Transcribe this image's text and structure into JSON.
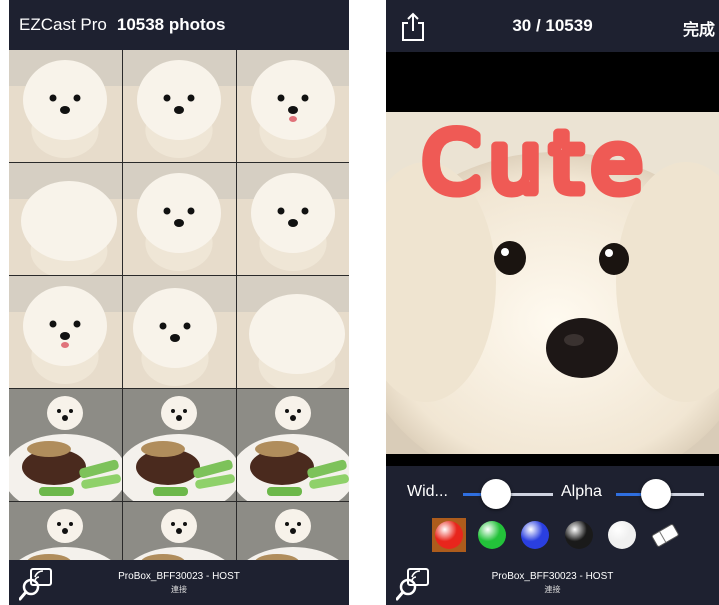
{
  "left": {
    "header": {
      "app_name": "EZCast Pro",
      "photo_count": "10538 photos"
    },
    "thumbnails": [
      "dog-face-front",
      "dog-face-front",
      "dog-face-smile",
      "dog-lying",
      "dog-face-up",
      "dog-face-front",
      "dog-face-smile",
      "dog-side",
      "dog-lying",
      "steak-plate",
      "steak-plate",
      "steak-plate",
      "steak-plate",
      "steak-plate",
      "steak-plate"
    ],
    "bottom_bar": {
      "device": "ProBox_BFF30023 - HOST",
      "status": "連接",
      "icon": "cast-search-icon"
    }
  },
  "right": {
    "header": {
      "pager": "30 / 10539",
      "done": "完成",
      "share_icon": "share-icon"
    },
    "annotation": {
      "text": "Cute",
      "color": "#ef5a55"
    },
    "tools": {
      "width_label": "Wid...",
      "alpha_label": "Alpha",
      "width_value": 0.37,
      "alpha_value": 0.45,
      "colors": [
        {
          "name": "red",
          "hex": "#e8261c",
          "selected": true
        },
        {
          "name": "green",
          "hex": "#23c23a",
          "selected": false
        },
        {
          "name": "blue",
          "hex": "#2a3fe0",
          "selected": false
        },
        {
          "name": "black",
          "hex": "#1a1a1a",
          "selected": false
        },
        {
          "name": "white",
          "hex": "#f0f0f0",
          "selected": false
        },
        {
          "name": "eraser",
          "hex": "#ffffff",
          "selected": false
        }
      ],
      "accent": "#2f6fe0"
    },
    "bottom_bar": {
      "device": "ProBox_BFF30023 - HOST",
      "status": "連接"
    }
  }
}
